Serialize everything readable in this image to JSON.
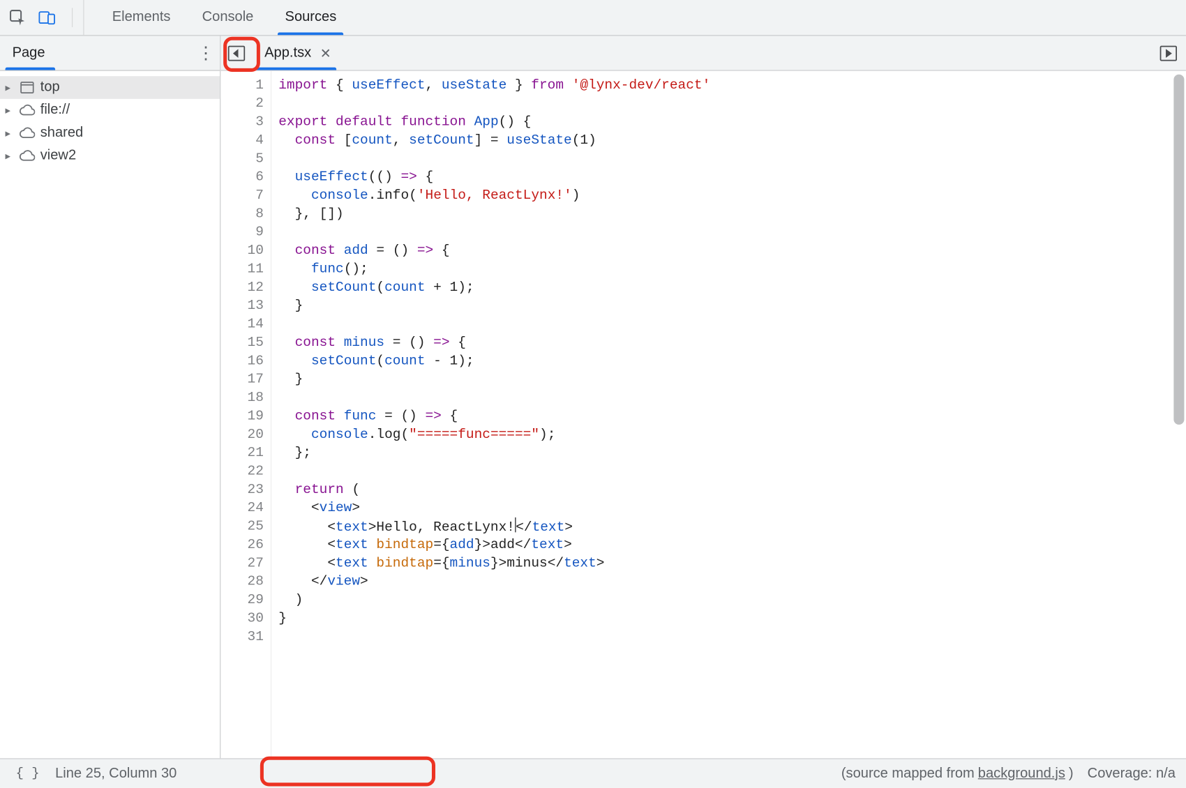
{
  "topbar": {
    "tabs": [
      "Elements",
      "Console",
      "Sources"
    ],
    "active_tab_index": 2
  },
  "sidebar": {
    "tab_label": "Page",
    "items": [
      {
        "label": "top",
        "icon": "frame",
        "selected": true
      },
      {
        "label": "file://",
        "icon": "cloud",
        "selected": false
      },
      {
        "label": "shared",
        "icon": "cloud",
        "selected": false
      },
      {
        "label": "view2",
        "icon": "cloud",
        "selected": false
      }
    ]
  },
  "editor": {
    "file_tab": "App.tsx",
    "line_count": 31,
    "code_lines": [
      [
        [
          "kw",
          "import"
        ],
        [
          "",
          " { "
        ],
        [
          "id",
          "useEffect"
        ],
        [
          "",
          ", "
        ],
        [
          "id",
          "useState"
        ],
        [
          "",
          " } "
        ],
        [
          "kw",
          "from"
        ],
        [
          "",
          " "
        ],
        [
          "str",
          "'@lynx-dev/react'"
        ]
      ],
      [],
      [
        [
          "kw",
          "export"
        ],
        [
          "",
          " "
        ],
        [
          "kw",
          "default"
        ],
        [
          "",
          " "
        ],
        [
          "kw",
          "function"
        ],
        [
          "",
          " "
        ],
        [
          "id",
          "App"
        ],
        [
          "",
          "() {"
        ]
      ],
      [
        [
          "",
          "  "
        ],
        [
          "kw",
          "const"
        ],
        [
          "",
          " ["
        ],
        [
          "id",
          "count"
        ],
        [
          "",
          ", "
        ],
        [
          "id",
          "setCount"
        ],
        [
          "",
          "] = "
        ],
        [
          "id",
          "useState"
        ],
        [
          "",
          "(1)"
        ]
      ],
      [],
      [
        [
          "",
          "  "
        ],
        [
          "id",
          "useEffect"
        ],
        [
          "",
          "(() "
        ],
        [
          "kw",
          "=>"
        ],
        [
          "",
          " {"
        ]
      ],
      [
        [
          "",
          "    "
        ],
        [
          "id",
          "console"
        ],
        [
          "",
          "."
        ],
        [
          "fn",
          "info"
        ],
        [
          "",
          "("
        ],
        [
          "str",
          "'Hello, ReactLynx!'"
        ],
        [
          "",
          ")"
        ]
      ],
      [
        [
          "",
          "  }, [])"
        ]
      ],
      [],
      [
        [
          "",
          "  "
        ],
        [
          "kw",
          "const"
        ],
        [
          "",
          " "
        ],
        [
          "id",
          "add"
        ],
        [
          "",
          " = () "
        ],
        [
          "kw",
          "=>"
        ],
        [
          "",
          " {"
        ]
      ],
      [
        [
          "",
          "    "
        ],
        [
          "id",
          "func"
        ],
        [
          "",
          "();"
        ]
      ],
      [
        [
          "",
          "    "
        ],
        [
          "id",
          "setCount"
        ],
        [
          "",
          "("
        ],
        [
          "id",
          "count"
        ],
        [
          "",
          " + 1);"
        ]
      ],
      [
        [
          "",
          "  }"
        ]
      ],
      [],
      [
        [
          "",
          "  "
        ],
        [
          "kw",
          "const"
        ],
        [
          "",
          " "
        ],
        [
          "id",
          "minus"
        ],
        [
          "",
          " = () "
        ],
        [
          "kw",
          "=>"
        ],
        [
          "",
          " {"
        ]
      ],
      [
        [
          "",
          "    "
        ],
        [
          "id",
          "setCount"
        ],
        [
          "",
          "("
        ],
        [
          "id",
          "count"
        ],
        [
          "",
          " - 1);"
        ]
      ],
      [
        [
          "",
          "  }"
        ]
      ],
      [],
      [
        [
          "",
          "  "
        ],
        [
          "kw",
          "const"
        ],
        [
          "",
          " "
        ],
        [
          "id",
          "func"
        ],
        [
          "",
          " = () "
        ],
        [
          "kw",
          "=>"
        ],
        [
          "",
          " {"
        ]
      ],
      [
        [
          "",
          "    "
        ],
        [
          "id",
          "console"
        ],
        [
          "",
          "."
        ],
        [
          "fn",
          "log"
        ],
        [
          "",
          "("
        ],
        [
          "str",
          "\"=====func=====\""
        ],
        [
          "",
          ");"
        ]
      ],
      [
        [
          "",
          "  };"
        ]
      ],
      [],
      [
        [
          "",
          "  "
        ],
        [
          "kw",
          "return"
        ],
        [
          "",
          " ("
        ]
      ],
      [
        [
          "",
          "    <"
        ],
        [
          "tag",
          "view"
        ],
        [
          "",
          ">"
        ]
      ],
      [
        [
          "",
          "      <"
        ],
        [
          "tag",
          "text"
        ],
        [
          "",
          ">Hello, ReactLynx!"
        ],
        [
          "cursor",
          ""
        ],
        [
          "",
          "</"
        ],
        [
          "tag",
          "text"
        ],
        [
          "",
          ">"
        ]
      ],
      [
        [
          "",
          "      <"
        ],
        [
          "tag",
          "text"
        ],
        [
          "",
          " "
        ],
        [
          "attr",
          "bindtap"
        ],
        [
          "",
          "={"
        ],
        [
          "id",
          "add"
        ],
        [
          "",
          "}>add</"
        ],
        [
          "tag",
          "text"
        ],
        [
          "",
          ">"
        ]
      ],
      [
        [
          "",
          "      <"
        ],
        [
          "tag",
          "text"
        ],
        [
          "",
          " "
        ],
        [
          "attr",
          "bindtap"
        ],
        [
          "",
          "={"
        ],
        [
          "id",
          "minus"
        ],
        [
          "",
          "}>minus</"
        ],
        [
          "tag",
          "text"
        ],
        [
          "",
          ">"
        ]
      ],
      [
        [
          "",
          "    </"
        ],
        [
          "tag",
          "view"
        ],
        [
          "",
          ">"
        ]
      ],
      [
        [
          "",
          "  )"
        ]
      ],
      [
        [
          "",
          "}"
        ]
      ],
      []
    ]
  },
  "statusbar": {
    "pretty_print": "{ }",
    "cursor_text": "Line 25, Column 30",
    "mapped_prefix": "(source mapped from ",
    "mapped_file": "background.js",
    "mapped_suffix": ")",
    "coverage_label": "Coverage: n/a"
  }
}
